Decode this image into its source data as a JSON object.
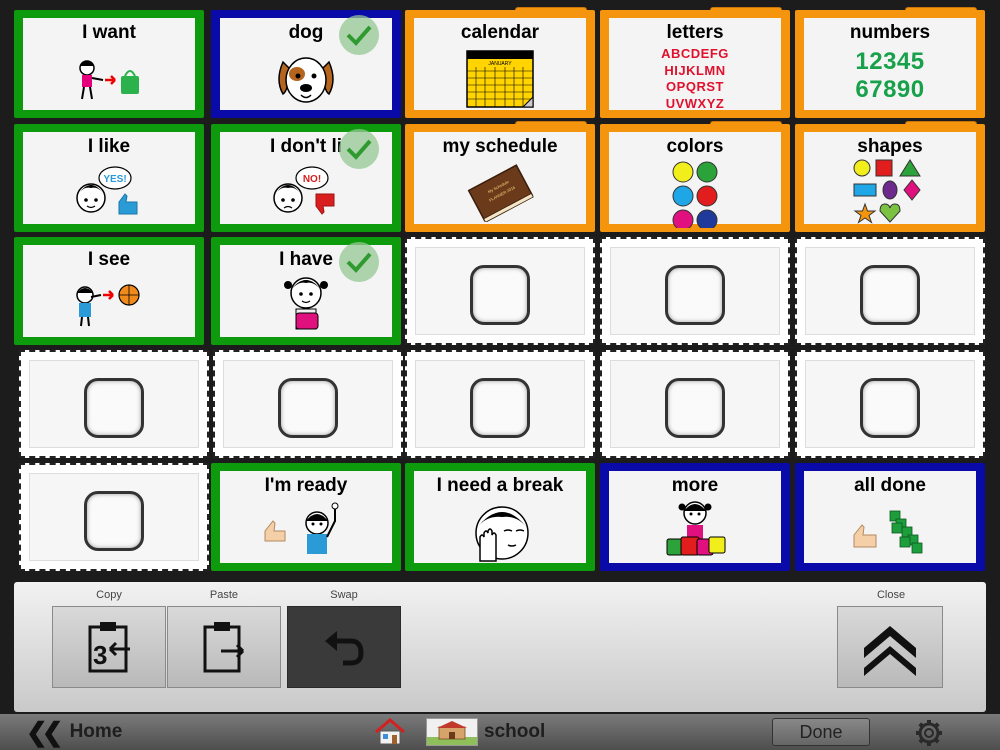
{
  "grid": {
    "cells": [
      {
        "label": "I want"
      },
      {
        "label": "dog"
      },
      {
        "label": "calendar",
        "calendar_month": "JANUARY"
      },
      {
        "label": "letters",
        "lines": [
          "ABCDEFG",
          "HIJKLMN",
          "OPQRST",
          "UVWXYZ"
        ]
      },
      {
        "label": "numbers",
        "lines": [
          "12345",
          "67890"
        ]
      },
      {
        "label": "I like",
        "bubble": "YES!"
      },
      {
        "label": "I don't li",
        "bubble": "NO!"
      },
      {
        "label": "my schedule",
        "book": [
          "My Schedule",
          "PLANNER 2016"
        ]
      },
      {
        "label": "colors"
      },
      {
        "label": "shapes"
      },
      {
        "label": "I see"
      },
      {
        "label": "I have"
      },
      {
        "label": "I'm ready"
      },
      {
        "label": "I need a break"
      },
      {
        "label": "more"
      },
      {
        "label": "all done"
      }
    ]
  },
  "toolbar": {
    "copy_label": "Copy",
    "paste_label": "Paste",
    "swap_label": "Swap",
    "close_label": "Close"
  },
  "nav": {
    "home_label": "Home",
    "page_name": "school",
    "done_label": "Done"
  },
  "colors": {
    "green_border": "#0d9a0d",
    "blue_border": "#0a0aa8",
    "orange_folder": "#f5950e",
    "letters_red": "#e0112d",
    "numbers_green": "#17a14a"
  }
}
